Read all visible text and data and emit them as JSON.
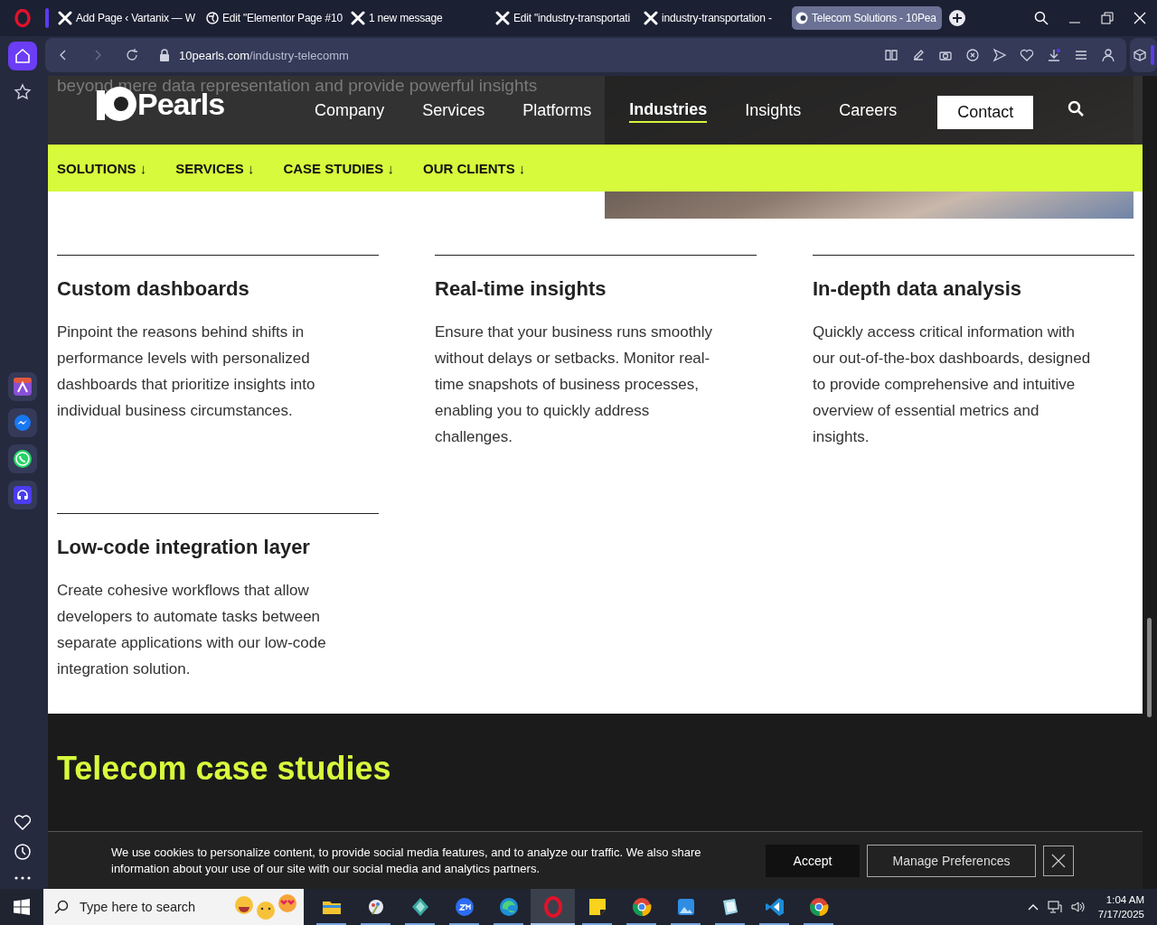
{
  "browser": {
    "tabs": [
      {
        "title": "Add Page ‹ Vartanix — W",
        "selected": false
      },
      {
        "title": "Edit \"Elementor Page #10",
        "selected": false
      },
      {
        "title": "1 new message",
        "selected": false
      },
      {
        "title": "Edit \"industry-transportati",
        "selected": false
      },
      {
        "title": "industry-transportation - ",
        "selected": false
      },
      {
        "title": "Telecom Solutions - 10Pea",
        "selected": true
      }
    ],
    "address": {
      "domain": "10pearls.com",
      "path": "/industry-telecomm"
    }
  },
  "page": {
    "behind_text": "beyond mere data representation and provide powerful insights",
    "logo": "Pearls",
    "nav": [
      {
        "label": "Company",
        "selected": false
      },
      {
        "label": "Services",
        "selected": false
      },
      {
        "label": "Platforms",
        "selected": false
      },
      {
        "label": "Industries",
        "selected": true
      },
      {
        "label": "Insights",
        "selected": false
      },
      {
        "label": "Careers",
        "selected": false
      }
    ],
    "contact": "Contact",
    "subnav": [
      "SOLUTIONS ↓",
      "SERVICES ↓",
      "CASE STUDIES ↓",
      "OUR CLIENTS ↓"
    ],
    "features": [
      {
        "title": "Custom dashboards",
        "body": "Pinpoint the reasons behind shifts in performance levels with personalized dashboards that prioritize insights into individual business circumstances."
      },
      {
        "title": "Real-time insights",
        "body": "Ensure that your business runs smoothly without delays or setbacks. Monitor real-time snapshots of business processes, enabling you to quickly address challenges."
      },
      {
        "title": "In-depth data analysis",
        "body": "Quickly access critical information with our out-of-the-box dashboards, designed to provide comprehensive and intuitive overview of essential metrics and insights."
      },
      {
        "title": "Low-code integration layer",
        "body": "Create cohesive workflows that allow developers to automate tasks between separate applications with our low-code integration solution."
      }
    ],
    "case_studies_title": "Telecom case studies",
    "cookie": {
      "text": "We use cookies to personalize content, to provide social media features, and to analyze our traffic. We also share information about your use of our site with our social media and analytics partners.",
      "accept": "Accept",
      "manage": "Manage Preferences"
    }
  },
  "taskbar": {
    "search_placeholder": "Type here to search",
    "apps": [
      {
        "selected": false
      },
      {
        "selected": false
      },
      {
        "selected": false
      },
      {
        "selected": false
      },
      {
        "selected": false
      },
      {
        "selected": true
      },
      {
        "selected": false
      },
      {
        "selected": false
      },
      {
        "selected": false
      },
      {
        "selected": false
      },
      {
        "selected": false
      },
      {
        "selected": false
      }
    ],
    "time": "1:04 AM",
    "date": "7/17/2025"
  }
}
